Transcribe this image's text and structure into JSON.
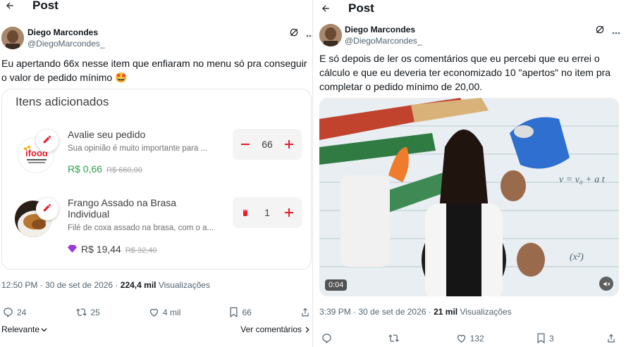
{
  "left": {
    "header": {
      "title": "Post"
    },
    "author": {
      "name": "Diego Marcondes",
      "handle": "@DiegoMarcondes_"
    },
    "tweet_text": "Eu apertando 66x nesse item que enfiaram no menu só pra conseguir o valor de pedido mínimo 🤩",
    "card": {
      "title": "Itens adicionados",
      "items": [
        {
          "name": "Avalie seu pedido",
          "description": "Sua opinião é muito importante para ...",
          "price": "R$ 0,66",
          "old_price": "R$ 660,00",
          "quantity": "66"
        },
        {
          "name": "Frango Assado na Brasa Individual",
          "description": "Filé de coxa assado na brasa, com o a...",
          "price": "R$ 19,44",
          "old_price": "R$ 32,40",
          "quantity": "1"
        }
      ]
    },
    "meta": {
      "time": "12:50 PM · 30 de set de 2026 · ",
      "views": "224,4 mil",
      "views_label": " Visualizações"
    },
    "actions": {
      "replies": "24",
      "reposts": "25",
      "likes": "4 mil",
      "bookmarks": "66"
    },
    "footer": {
      "sort": "Relevante",
      "view_replies": "Ver comentários"
    }
  },
  "right": {
    "header": {
      "title": "Post"
    },
    "author": {
      "name": "Diego Marcondes",
      "handle": "@DiegoMarcondes_"
    },
    "tweet_text": "E só depois de ler os comentários que eu percebi que eu errei o cálculo e que eu deveria ter economizado 10 \"apertos\" no item pra completar o pedido mínimo de 20,00.",
    "video": {
      "duration": "0:04"
    },
    "meta": {
      "time": "3:39 PM · 30 de set de 2026 · ",
      "views": "21 mil",
      "views_label": " Visualizações"
    },
    "actions": {
      "replies": "",
      "reposts": "",
      "likes": "132",
      "bookmarks": "3"
    }
  },
  "colors": {
    "ifood_red": "#ea1d2c",
    "price_green": "#2e9f4e",
    "premium_purple": "#9b3ad6"
  },
  "icons": [
    "back-arrow-icon",
    "grok-icon",
    "more-icon",
    "reply-icon",
    "repost-icon",
    "like-icon",
    "bookmark-icon",
    "share-icon",
    "edit-pencil-icon",
    "trash-icon",
    "minus-icon",
    "plus-icon",
    "diamond-icon",
    "mute-icon",
    "chevron-down-icon",
    "chevron-right-icon"
  ]
}
